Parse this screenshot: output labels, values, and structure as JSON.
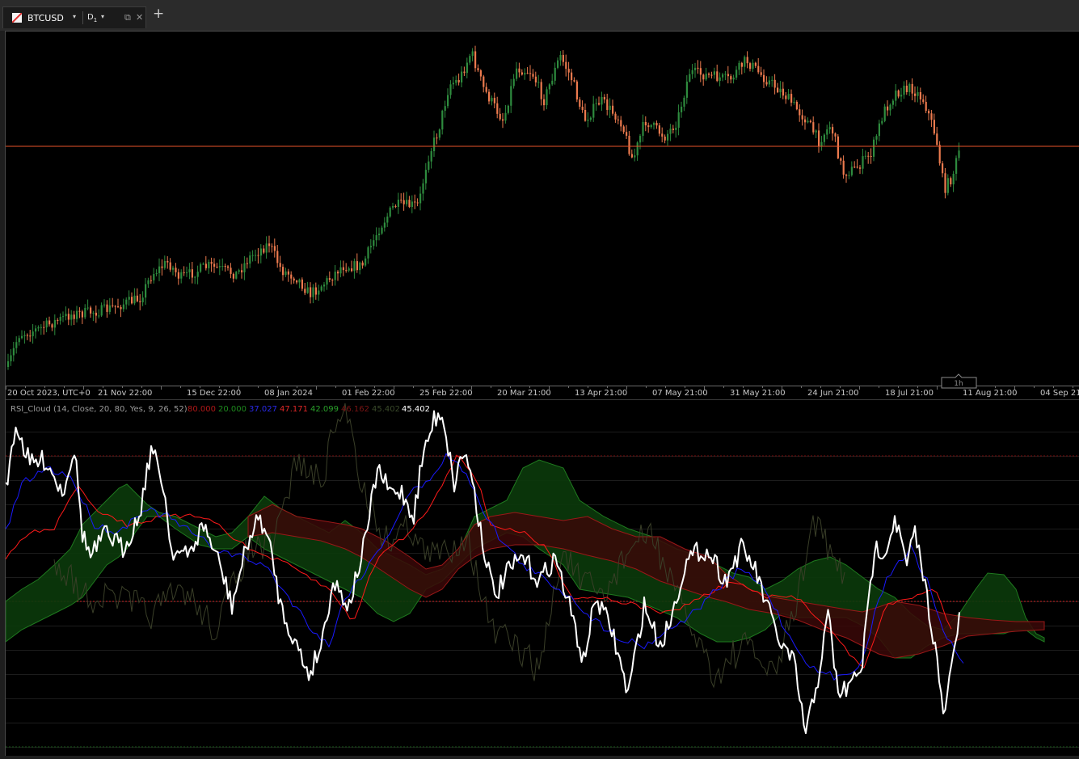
{
  "tab": {
    "symbol": "BTCUSD",
    "timeframe": "D",
    "timeframe_sub": "1",
    "dropdown": "▾",
    "popout": "⧉",
    "close": "✕"
  },
  "toolbar": {
    "add": "+"
  },
  "time_axis": {
    "labels": [
      "20 Oct 2023, UTC+0",
      "21 Nov 22:00",
      "15 Dec 22:00",
      "08 Jan 2024",
      "01 Feb 22:00",
      "25 Feb 22:00",
      "20 Mar 21:00",
      "13 Apr 21:00",
      "07 May 21:00",
      "31 May 21:00",
      "24 Jun 21:00",
      "18 Jul 21:00",
      "11 Aug 21:00",
      "04 Sep 21:00"
    ],
    "timeframe_marker": "1h"
  },
  "indicator": {
    "title": "RSI_Cloud (14, Close, 20, 80, Yes, 9, 26, 52)",
    "values": [
      {
        "text": "80.000",
        "color": "#b01818"
      },
      {
        "text": "20.000",
        "color": "#1e8a1e"
      },
      {
        "text": "37.027",
        "color": "#2a2ae8"
      },
      {
        "text": "47.171",
        "color": "#e02828"
      },
      {
        "text": "42.099",
        "color": "#2aa02a"
      },
      {
        "text": "46.162",
        "color": "#7a1414"
      },
      {
        "text": "45.402",
        "color": "#3a4a2a"
      },
      {
        "text": "45.402",
        "color": "#ffffff"
      }
    ]
  },
  "colors": {
    "bull": "#2e8b3e",
    "bear": "#ec7a4e",
    "price_line": "#e8552a",
    "rsi": "#ffffff",
    "signal_blue": "#1a1aff",
    "signal_red": "#ff1a1a",
    "cloud_green": "#0d3d0d",
    "cloud_red": "#3d0a0a",
    "lagging": "#3a3f28"
  }
}
